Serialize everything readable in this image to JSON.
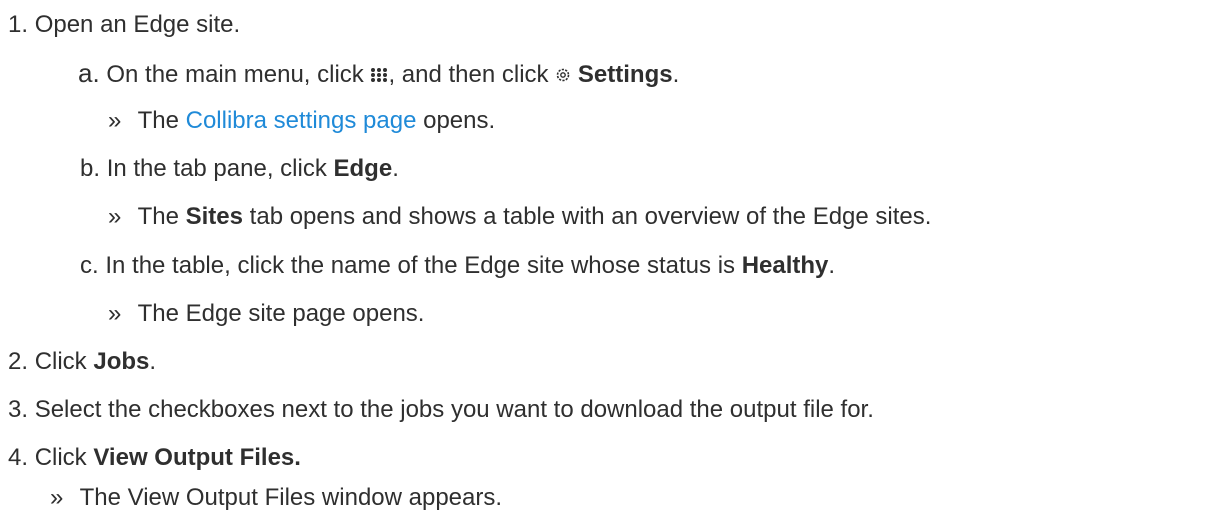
{
  "steps": {
    "s1": {
      "num": "1.",
      "text": "Open an Edge site."
    },
    "s1a": {
      "num": "a.",
      "t1": "On the main menu, click",
      "icon1": "grid-icon",
      "t2": ", and then click",
      "icon2": "gear-icon",
      "bold": "Settings",
      "t3": "."
    },
    "s1a_r": {
      "marker": "»",
      "t1": "The",
      "link": "Collibra settings page",
      "t2": "opens."
    },
    "s1b": {
      "num": "b.",
      "t1": "In the tab pane, click",
      "bold": "Edge",
      "t2": "."
    },
    "s1b_r": {
      "marker": "»",
      "t1": "The",
      "bold": "Sites",
      "t2": "tab opens and shows a table with an overview of the Edge sites."
    },
    "s1c": {
      "num": "c.",
      "t1": "In the table, click the name of the Edge site whose status is",
      "bold": "Healthy",
      "t2": "."
    },
    "s1c_r": {
      "marker": "»",
      "text": "The Edge site page opens."
    },
    "s2": {
      "num": "2.",
      "t1": "Click",
      "bold": "Jobs",
      "t2": "."
    },
    "s3": {
      "num": "3.",
      "text": "Select the checkboxes next to the jobs you want to download the output file for."
    },
    "s4": {
      "num": "4.",
      "t1": "Click",
      "bold": "View Output Files."
    },
    "s4_r": {
      "marker": "»",
      "text": "The View Output Files window appears."
    }
  },
  "colors": {
    "text": "#2f2f2f",
    "link": "#1f8ad8"
  }
}
